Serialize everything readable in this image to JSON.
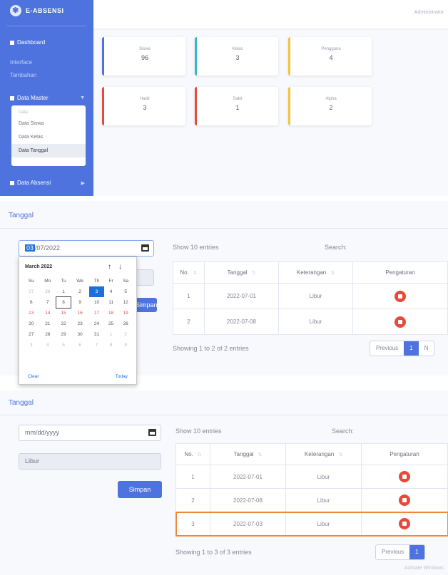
{
  "dashboard": {
    "brand": "E-ABSENSI",
    "topbar_user": "Administrator",
    "sidebar": {
      "dashboard": "Dashboard",
      "heading_1": "Interface",
      "heading_2": "Tambahan",
      "data_master": "Data Master",
      "submenu_header": "Data:",
      "submenu": [
        "Data Siswa",
        "Data Kelas",
        "Data Tanggal"
      ],
      "data_absensi": "Data Absensi"
    },
    "stats": [
      {
        "label": "Siswa",
        "value": "96"
      },
      {
        "label": "Kelas",
        "value": "3"
      },
      {
        "label": "Pengguna",
        "value": "4"
      },
      {
        "label": "Hadir",
        "value": "3"
      },
      {
        "label": "Sakit",
        "value": "1"
      },
      {
        "label": "Alpha",
        "value": "2"
      }
    ]
  },
  "form_open": {
    "title": "Tanggal",
    "date_value_highlight": "03",
    "date_value_rest": "/07/2022",
    "save_label": "Simpan",
    "show_text": "Show  10  entries",
    "search_label": "Search:",
    "headers": [
      "No.",
      "Tanggal",
      "Keterangan",
      "Pengaturan"
    ],
    "rows": [
      {
        "no": "1",
        "tanggal": "2022-07-01",
        "ket": "Libur"
      },
      {
        "no": "2",
        "tanggal": "2022-07-08",
        "ket": "Libur"
      }
    ],
    "info": "Showing 1 to 2 of 2 entries",
    "prev": "Previous",
    "page": "1",
    "next": "N",
    "picker": {
      "month": "March 2022",
      "days": [
        "Su",
        "Mo",
        "Tu",
        "We",
        "Th",
        "Fr",
        "Sa"
      ],
      "clear": "Clear",
      "today": "Today"
    }
  },
  "form_saved": {
    "title": "Tanggal",
    "date_placeholder": "mm/dd/yyyy",
    "ket_value": "Libur",
    "save_label": "Simpan",
    "show_text": "Show  10  entries",
    "search_label": "Search:",
    "headers": [
      "No.",
      "Tanggal",
      "Keterangan",
      "Pengaturan"
    ],
    "rows": [
      {
        "no": "1",
        "tanggal": "2022-07-01",
        "ket": "Libur"
      },
      {
        "no": "2",
        "tanggal": "2022-07-08",
        "ket": "Libur"
      },
      {
        "no": "3",
        "tanggal": "2022-07-03",
        "ket": "Libur"
      }
    ],
    "info": "Showing 1 to 3 of 3 entries",
    "prev": "Previous",
    "page": "1",
    "footer": "Activate Windows"
  },
  "colors": {
    "primary": "#4e73df",
    "info": "#36b9cc",
    "warning": "#f6c23e",
    "danger": "#e74a3b",
    "highlight": "#f0883a"
  }
}
